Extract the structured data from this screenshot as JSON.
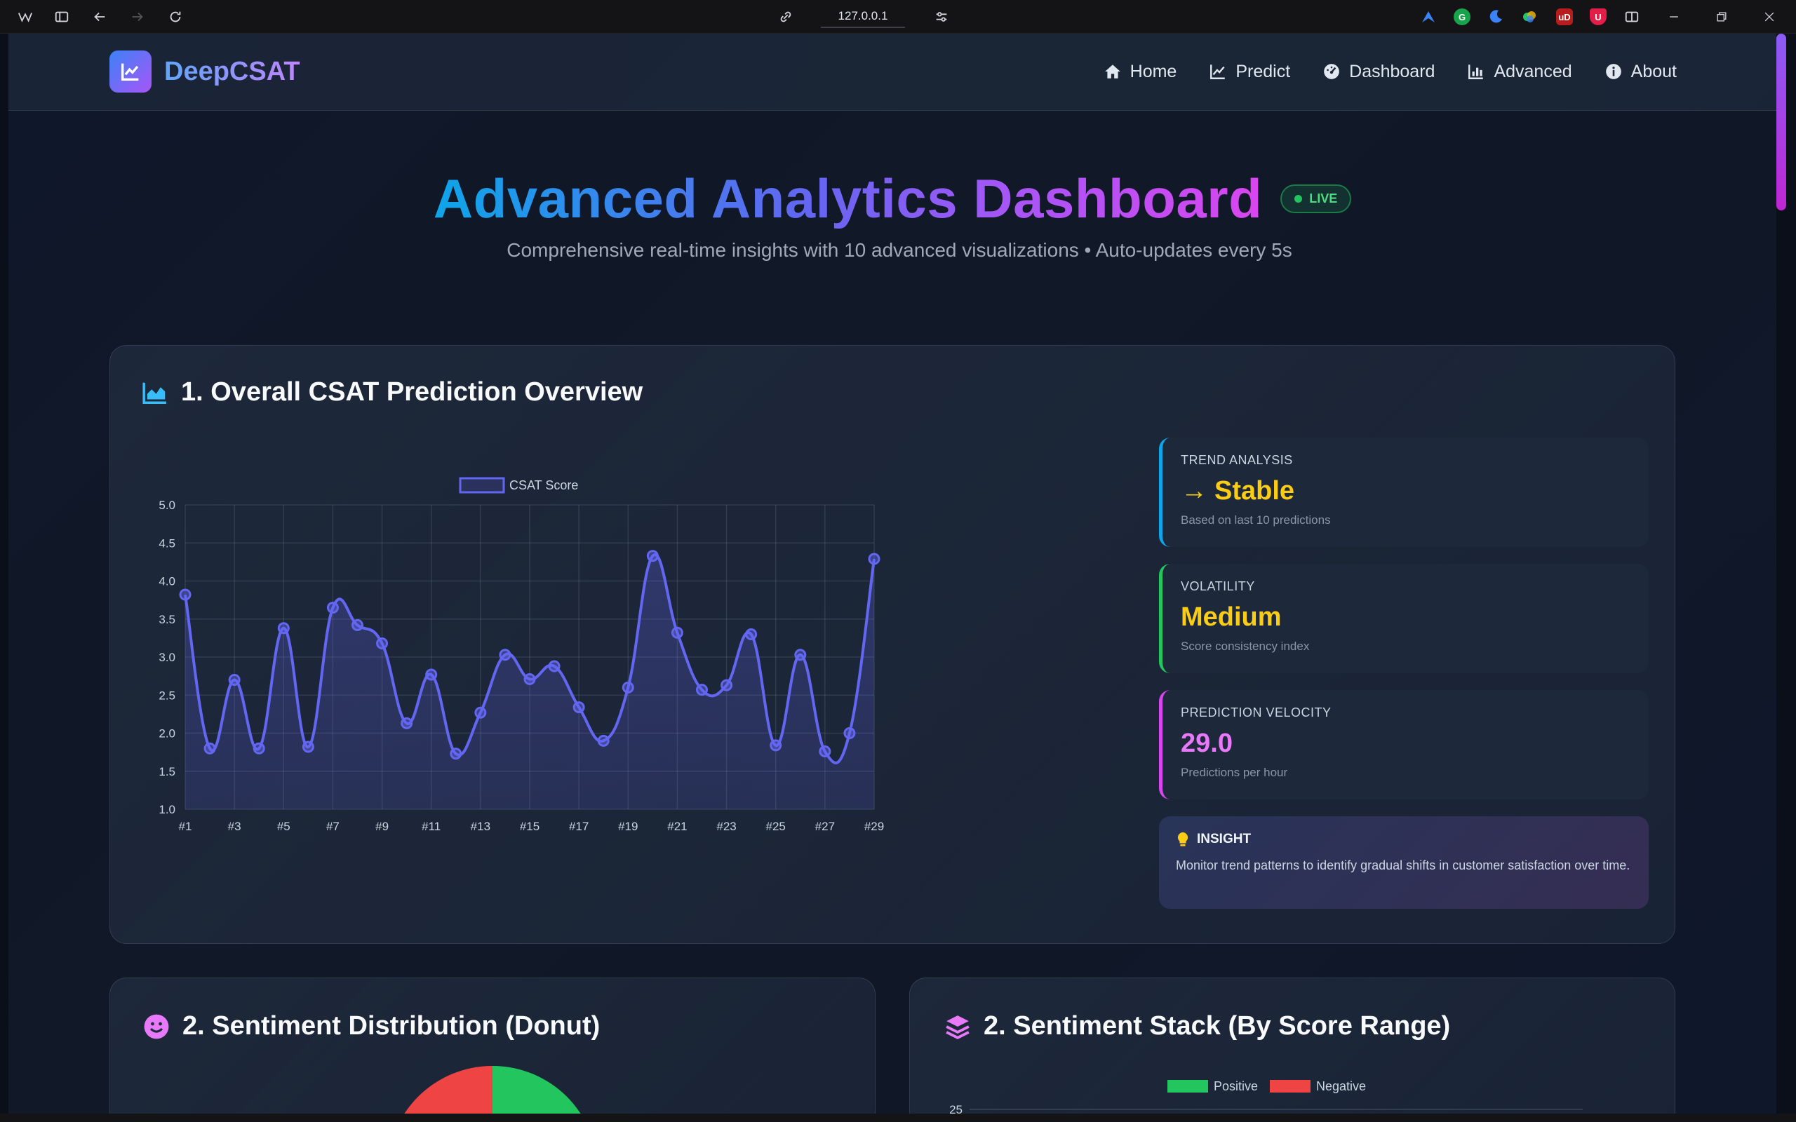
{
  "browser": {
    "url": "127.0.0.1"
  },
  "nav": {
    "brand": "DeepCSAT",
    "links": [
      {
        "label": "Home",
        "icon": "home-icon"
      },
      {
        "label": "Predict",
        "icon": "chart-line-icon"
      },
      {
        "label": "Dashboard",
        "icon": "gauge-icon"
      },
      {
        "label": "Advanced",
        "icon": "chart-bar-icon"
      },
      {
        "label": "About",
        "icon": "info-icon"
      }
    ]
  },
  "header": {
    "title": "Advanced Analytics Dashboard",
    "live_badge": "LIVE",
    "subtitle": "Comprehensive real-time insights with 10 advanced visualizations • Auto-updates every 5s"
  },
  "overview": {
    "title": "1. Overall CSAT Prediction Overview",
    "stats": [
      {
        "label": "TREND ANALYSIS",
        "value": "Stable",
        "value_prefix": "→",
        "desc": "Based on last 10 predictions",
        "color": "#facc15",
        "accent": "#0ea5e9"
      },
      {
        "label": "VOLATILITY",
        "value": "Medium",
        "desc": "Score consistency index",
        "color": "#facc15",
        "accent": "#22c55e"
      },
      {
        "label": "PREDICTION VELOCITY",
        "value": "29.0",
        "desc": "Predictions per hour",
        "color": "#e879f9",
        "accent": "#d946ef"
      }
    ],
    "insight": {
      "label": "INSIGHT",
      "text": "Monitor trend patterns to identify gradual shifts in customer satisfaction over time."
    }
  },
  "sentiment_donut": {
    "title": "2. Sentiment Distribution (Donut)"
  },
  "sentiment_stack": {
    "title": "2. Sentiment Stack (By Score Range)",
    "legend": [
      "Positive",
      "Negative"
    ],
    "y_top_tick": "25"
  },
  "chart_data": [
    {
      "type": "line",
      "series": [
        {
          "name": "CSAT Score",
          "values": [
            3.82,
            1.8,
            2.7,
            1.8,
            3.38,
            1.82,
            3.65,
            3.42,
            3.18,
            2.13,
            2.77,
            1.73,
            2.27,
            3.03,
            2.71,
            2.88,
            2.34,
            1.9,
            2.6,
            4.33,
            3.32,
            2.57,
            2.63,
            3.3,
            1.84,
            3.03,
            1.76,
            2.0,
            4.29
          ]
        }
      ],
      "x": [
        "#1",
        "#2",
        "#3",
        "#4",
        "#5",
        "#6",
        "#7",
        "#8",
        "#9",
        "#10",
        "#11",
        "#12",
        "#13",
        "#14",
        "#15",
        "#16",
        "#17",
        "#18",
        "#19",
        "#20",
        "#21",
        "#22",
        "#23",
        "#24",
        "#25",
        "#26",
        "#27",
        "#28",
        "#29"
      ],
      "x_tick_labels": [
        "#1",
        "#3",
        "#5",
        "#7",
        "#9",
        "#11",
        "#13",
        "#15",
        "#17",
        "#19",
        "#21",
        "#23",
        "#25",
        "#27",
        "#29"
      ],
      "y_ticks": [
        "1.0",
        "1.5",
        "2.0",
        "2.5",
        "3.0",
        "3.5",
        "4.0",
        "4.5",
        "5.0"
      ],
      "ylim": [
        1.0,
        5.0
      ],
      "legend": "top",
      "grid": true,
      "color": "#6366f1"
    },
    {
      "type": "pie",
      "variant": "donut",
      "slices": [
        {
          "name": "Positive",
          "color": "#22c55e"
        },
        {
          "name": "Negative",
          "color": "#ef4444"
        }
      ]
    },
    {
      "type": "bar",
      "stacked": true,
      "series": [
        {
          "name": "Positive",
          "color": "#22c55e"
        },
        {
          "name": "Negative",
          "color": "#ef4444"
        }
      ],
      "y_ticks": [
        "25"
      ]
    }
  ]
}
